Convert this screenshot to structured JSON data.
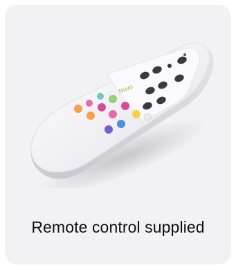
{
  "card": {
    "caption": "Remote control supplied",
    "image_icon": "remote-control-icon",
    "colors": {
      "card_background": "#f2f2f4",
      "caption_text": "#111111",
      "remote_body": "#f3f3f6",
      "button_dark": "#3a3a3e",
      "button_orange": "#f5a04a",
      "button_yellow": "#f4d34a",
      "button_green": "#8fd27a",
      "button_teal": "#6cc9c4",
      "button_pink": "#e86aa8",
      "button_magenta": "#d84a9a",
      "button_blue": "#4a8fe0",
      "button_purple": "#7a5ad0"
    }
  }
}
